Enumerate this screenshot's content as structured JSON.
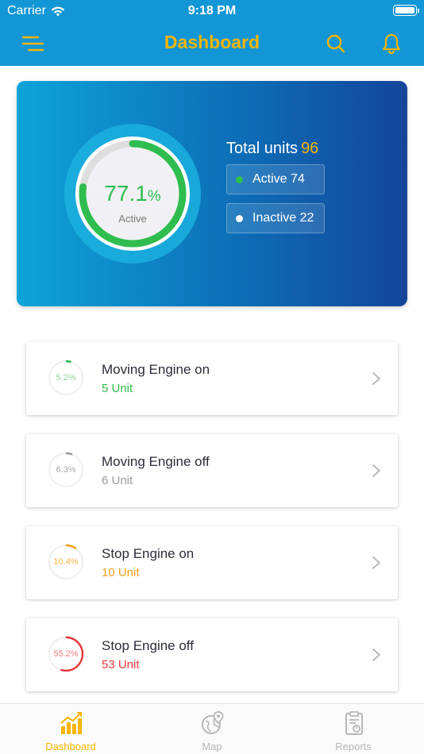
{
  "status_bar": {
    "carrier": "Carrier",
    "time": "9:18 PM"
  },
  "nav": {
    "title": "Dashboard",
    "menu_icon": "menu-icon",
    "search_icon": "search-icon",
    "bell_icon": "bell-icon"
  },
  "summary": {
    "active_percent": "77.1",
    "percent_symbol": "%",
    "gauge_label": "Active",
    "gauge_fraction": 0.771,
    "total_label": "Total units",
    "total_value": "96",
    "active_chip": "Active 74",
    "inactive_chip": "Inactive 22",
    "colors": {
      "active": "#2ebd4e",
      "accent": "#f7b500"
    }
  },
  "rows": [
    {
      "title": "Moving Engine on",
      "units": "5 Unit",
      "percent": "5.2%",
      "fraction": 0.052,
      "color": "#2ebd4e",
      "label_color": "#8fd39c"
    },
    {
      "title": "Moving Engine off",
      "units": "6 Unit",
      "percent": "6.3%",
      "fraction": 0.063,
      "color": "#9a9a9a",
      "label_color": "#a8a8a8"
    },
    {
      "title": "Stop Engine on",
      "units": "10 Unit",
      "percent": "10.4%",
      "fraction": 0.104,
      "color": "#f0a11c",
      "label_color": "#f2b54b"
    },
    {
      "title": "Stop Engine off",
      "units": "53 Unit",
      "percent": "55.2%",
      "fraction": 0.552,
      "color": "#e8373a",
      "label_color": "#ef7a7c"
    }
  ],
  "tabs": [
    {
      "label": "Dashboard",
      "icon": "bar-chart-icon",
      "selected": true
    },
    {
      "label": "Map",
      "icon": "map-pin-globe-icon",
      "selected": false
    },
    {
      "label": "Reports",
      "icon": "clipboard-report-icon",
      "selected": false
    }
  ],
  "colors": {
    "header": "#1296d5",
    "tab_selected": "#f7b500",
    "tab_inactive": "#b7b7b7"
  }
}
